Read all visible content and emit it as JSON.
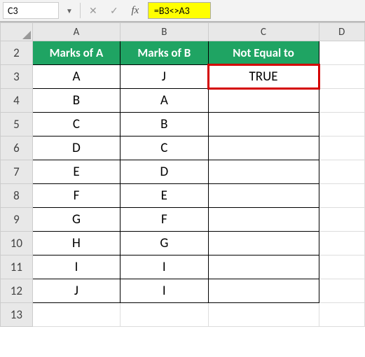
{
  "formula_bar": {
    "name_box": "C3",
    "cancel_icon": "✕",
    "confirm_icon": "✓",
    "fx_label": "fx",
    "formula": "=B3<>A3"
  },
  "columns": [
    "A",
    "B",
    "C",
    "D"
  ],
  "rows": [
    "2",
    "3",
    "4",
    "5",
    "6",
    "7",
    "8",
    "9",
    "10",
    "11",
    "12",
    "13"
  ],
  "headers": {
    "a": "Marks of A",
    "b": "Marks of B",
    "c": "Not Equal to"
  },
  "data": {
    "r3": {
      "a": "A",
      "b": "J",
      "c": "TRUE"
    },
    "r4": {
      "a": "B",
      "b": "A",
      "c": ""
    },
    "r5": {
      "a": "C",
      "b": "B",
      "c": ""
    },
    "r6": {
      "a": "D",
      "b": "C",
      "c": ""
    },
    "r7": {
      "a": "E",
      "b": "D",
      "c": ""
    },
    "r8": {
      "a": "F",
      "b": "E",
      "c": ""
    },
    "r9": {
      "a": "G",
      "b": "F",
      "c": ""
    },
    "r10": {
      "a": "H",
      "b": "G",
      "c": ""
    },
    "r11": {
      "a": "I",
      "b": "I",
      "c": ""
    },
    "r12": {
      "a": "J",
      "b": "I",
      "c": ""
    }
  }
}
